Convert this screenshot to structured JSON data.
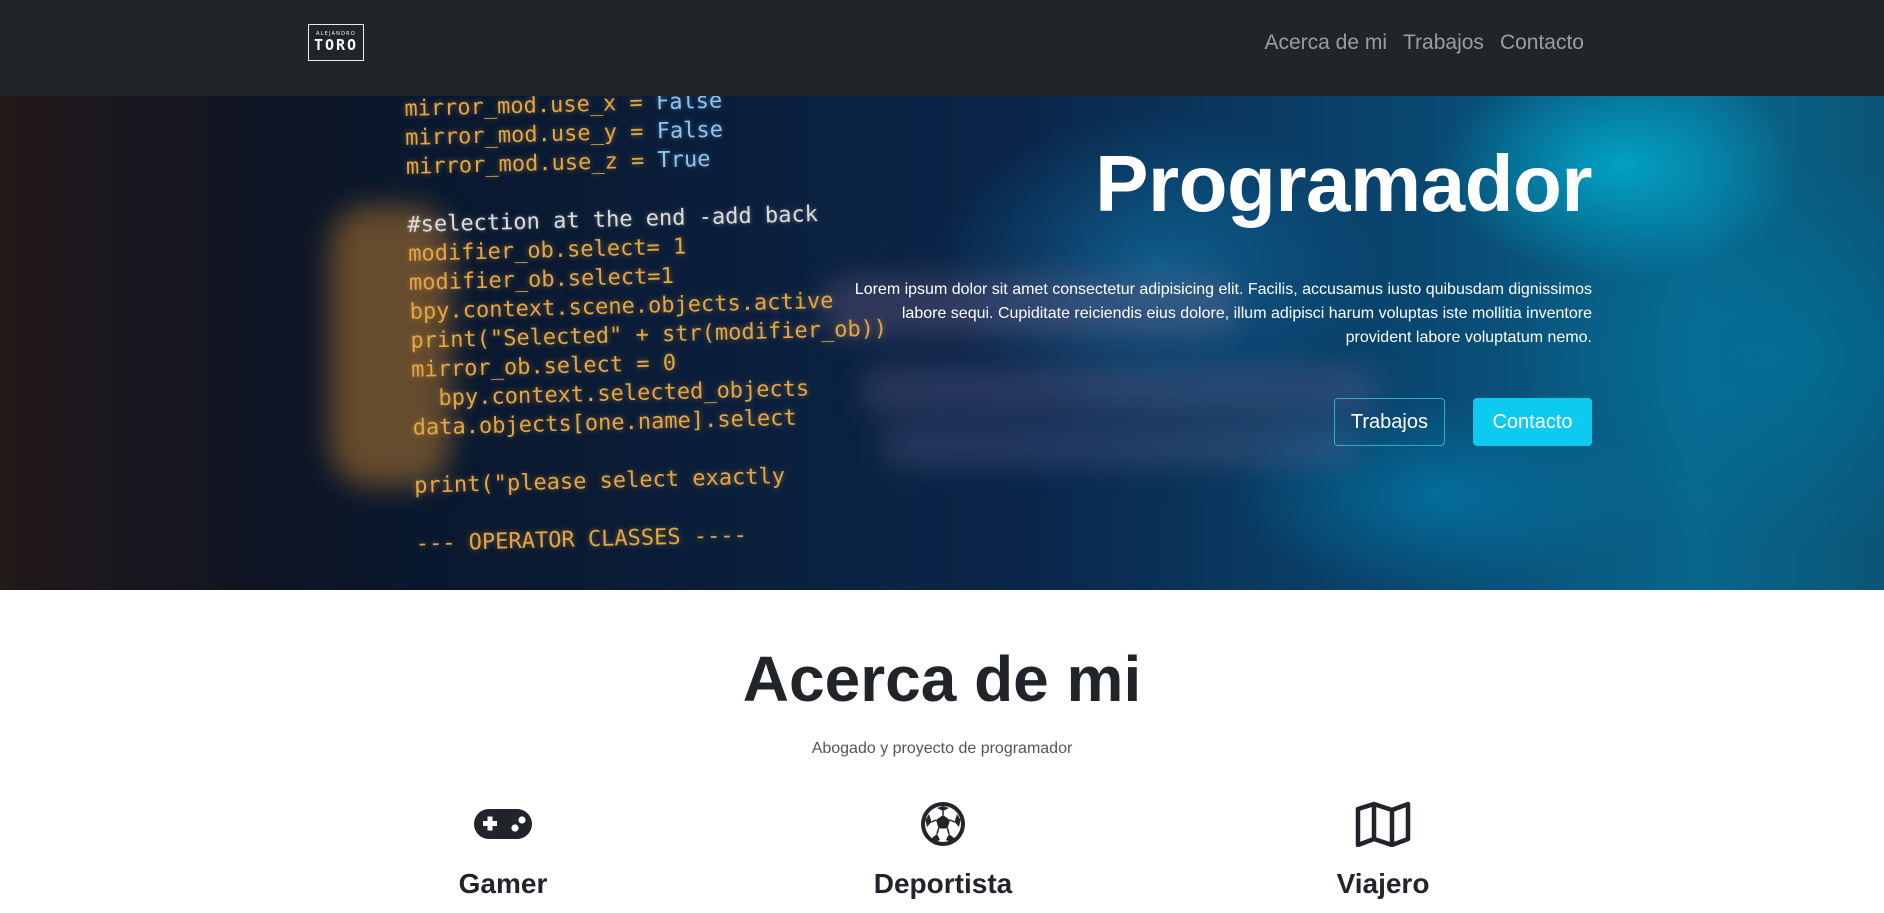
{
  "navbar": {
    "logo": {
      "top": "ALEJANDRO",
      "main": "TORO"
    },
    "links": [
      "Acerca de mi",
      "Trabajos",
      "Contacto"
    ]
  },
  "hero": {
    "title": "Programador",
    "text": "Lorem ipsum dolor sit amet consectetur adipisicing elit. Facilis, accusamus iusto quibusdam dignissimos labore sequi. Cupiditate reiciendis eius dolore, illum adipisci harum voluptas iste mollitia inventore provident labore voluptatum nemo.",
    "buttons": {
      "works": "Trabajos",
      "contact": "Contacto"
    },
    "code_lines": [
      "mirror_mod.use_x = False",
      "mirror_mod.use_y = False",
      "mirror_mod.use_z = True",
      "",
      "#selection at the end -add back",
      "modifier_ob.select= 1",
      "modifier_ob.select=1",
      "bpy.context.scene.objects.active",
      "print(\"Selected\" + str(modifier_ob))",
      "mirror_ob.select = 0",
      "  bpy.context.selected_objects",
      "data.objects[one.name].select",
      "",
      "print(\"please select exactly",
      "",
      "--- OPERATOR CLASSES ----"
    ]
  },
  "about": {
    "title": "Acerca de mi",
    "subtitle": "Abogado y proyecto de programador",
    "features": [
      {
        "title": "Gamer",
        "icon": "gamepad-icon"
      },
      {
        "title": "Deportista",
        "icon": "soccer-ball-icon"
      },
      {
        "title": "Viajero",
        "icon": "map-icon"
      }
    ]
  },
  "colors": {
    "navbar_bg": "#212529",
    "accent": "#0dcaf0",
    "text_dark": "#212529"
  }
}
